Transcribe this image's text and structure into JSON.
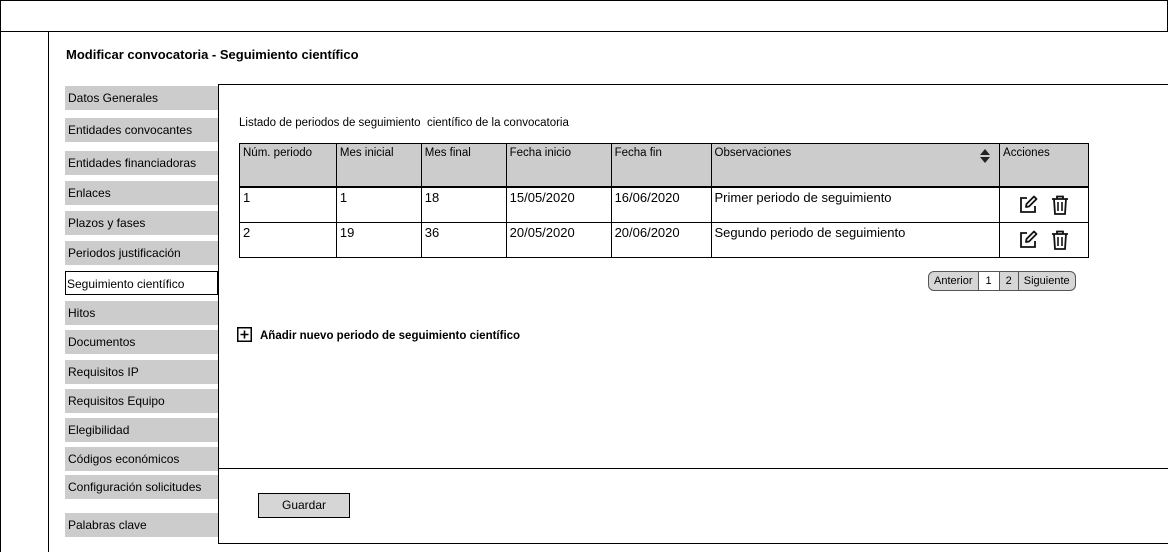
{
  "page_title": "Modificar convocatoria - Seguimiento científico",
  "sidebar": {
    "items": [
      {
        "label": "Datos Generales"
      },
      {
        "label": "Entidades convocantes"
      },
      {
        "label": "Entidades financiadoras"
      },
      {
        "label": "Enlaces"
      },
      {
        "label": "Plazos y fases"
      },
      {
        "label": "Periodos justificación"
      },
      {
        "label": "Seguimiento científico",
        "active": true
      },
      {
        "label": "Hitos"
      },
      {
        "label": "Documentos"
      },
      {
        "label": "Requisitos IP"
      },
      {
        "label": "Requisitos Equipo"
      },
      {
        "label": "Elegibilidad"
      },
      {
        "label": "Códigos económicos"
      },
      {
        "label": "Configuración solicitudes"
      },
      {
        "label": "Palabras clave"
      }
    ]
  },
  "main": {
    "list_title": "Listado de periodos de seguimiento  científico de la convocatoria",
    "table": {
      "columns": [
        "Núm. periodo",
        "Mes inicial",
        "Mes final",
        "Fecha inicio",
        "Fecha fin",
        "Observaciones",
        "Acciones"
      ],
      "rows": [
        [
          "1",
          "1",
          "18",
          "15/05/2020",
          "16/06/2020",
          "Primer periodo de seguimiento"
        ],
        [
          "2",
          "19",
          "36",
          "20/05/2020",
          "20/06/2020",
          "Segundo periodo de seguimiento"
        ]
      ],
      "row_actions": [
        "edit-icon",
        "trash-icon"
      ],
      "sort_icon": "sort-icon"
    },
    "pagination": {
      "previous": "Anterior",
      "pages": [
        "1",
        "2"
      ],
      "next": "Siguiente"
    },
    "add_label": "Añadir nuevo periodo de seguimiento científico",
    "add_icon": "plus-box-icon"
  },
  "footer": {
    "save_label": "Guardar"
  }
}
